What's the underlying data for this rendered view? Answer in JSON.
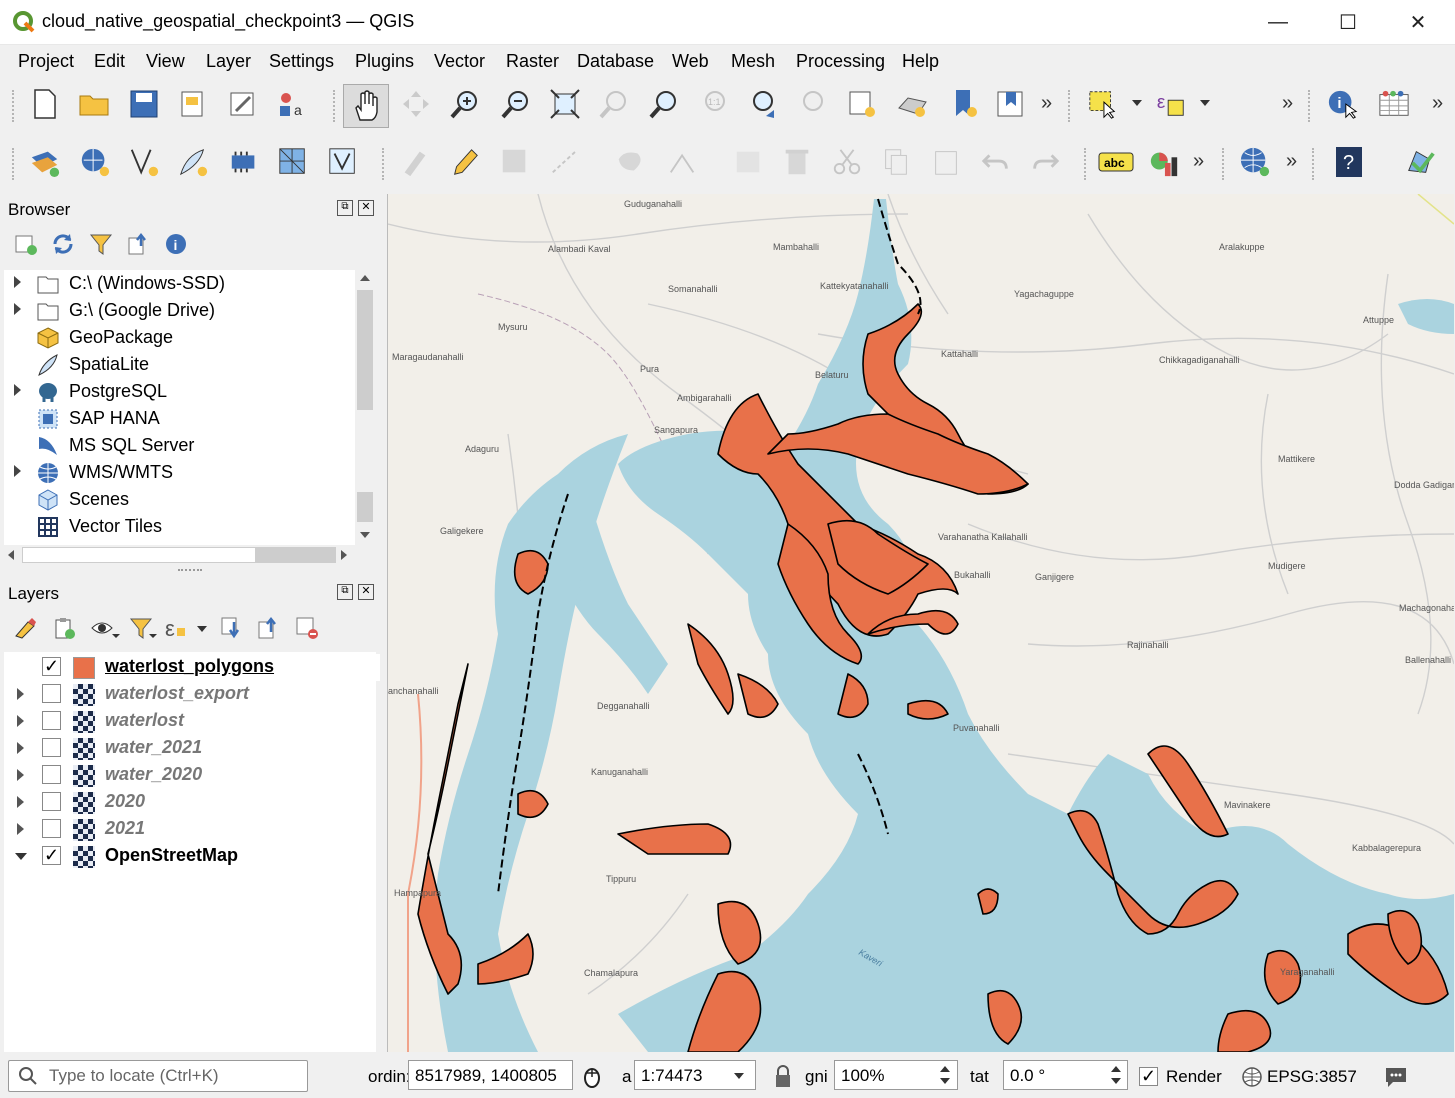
{
  "window": {
    "title": "cloud_native_geospatial_checkpoint3 — QGIS",
    "minimize_glyph": "—",
    "maximize_glyph": "☐",
    "close_glyph": "✕"
  },
  "menu": [
    {
      "label": "Project"
    },
    {
      "label": "Edit"
    },
    {
      "label": "View"
    },
    {
      "label": "Layer"
    },
    {
      "label": "Settings"
    },
    {
      "label": "Plugins"
    },
    {
      "label": "Vector"
    },
    {
      "label": "Raster"
    },
    {
      "label": "Database"
    },
    {
      "label": "Web"
    },
    {
      "label": "Mesh"
    },
    {
      "label": "Processing"
    },
    {
      "label": "Help"
    }
  ],
  "toolbar_overflow": "»",
  "browser": {
    "title": "Browser",
    "items": [
      {
        "label": "C:\\ (Windows-SSD)",
        "icon": "folder-icon",
        "expandable": true
      },
      {
        "label": "G:\\ (Google Drive)",
        "icon": "folder-icon",
        "expandable": true
      },
      {
        "label": "GeoPackage",
        "icon": "geopackage-icon",
        "expandable": false
      },
      {
        "label": "SpatiaLite",
        "icon": "spatialite-feather-icon",
        "expandable": false
      },
      {
        "label": "PostgreSQL",
        "icon": "postgresql-elephant-icon",
        "expandable": true
      },
      {
        "label": "SAP HANA",
        "icon": "sap-hana-icon",
        "expandable": false
      },
      {
        "label": "MS SQL Server",
        "icon": "mssql-icon",
        "expandable": false
      },
      {
        "label": "WMS/WMTS",
        "icon": "globe-icon",
        "expandable": true
      },
      {
        "label": "Scenes",
        "icon": "cube-icon",
        "expandable": false
      },
      {
        "label": "Vector Tiles",
        "icon": "grid-icon",
        "expandable": false
      }
    ]
  },
  "layers": {
    "title": "Layers",
    "items": [
      {
        "label": "waterlost_polygons",
        "checked": true,
        "check_glyph": "✓",
        "type": "polygon",
        "active": true
      },
      {
        "label": "waterlost_export",
        "checked": false,
        "check_glyph": "",
        "type": "raster",
        "active": false
      },
      {
        "label": "waterlost",
        "checked": false,
        "check_glyph": "",
        "type": "raster",
        "active": false
      },
      {
        "label": "water_2021",
        "checked": false,
        "check_glyph": "",
        "type": "raster",
        "active": false
      },
      {
        "label": "water_2020",
        "checked": false,
        "check_glyph": "",
        "type": "raster",
        "active": false
      },
      {
        "label": "2020",
        "checked": false,
        "check_glyph": "",
        "type": "raster",
        "active": false
      },
      {
        "label": "2021",
        "checked": false,
        "check_glyph": "",
        "type": "raster",
        "active": false
      },
      {
        "label": "OpenStreetMap",
        "checked": true,
        "check_glyph": "✓",
        "type": "raster",
        "active": true
      }
    ]
  },
  "map": {
    "water_color": "#aad3df",
    "polygon_color": "#e8714a",
    "land_color": "#f2efe9",
    "place_labels": [
      "Guduganahalli",
      "Alambadi Kaval",
      "Mambahalli",
      "Somanahalli",
      "Kattekyatanahalli",
      "Yagachaguppe",
      "Aralakuppe",
      "Attuppe",
      "Maragaudanahalli",
      "Mysuru",
      "Kattahalli",
      "Chikkagadiganahalli",
      "Pura",
      "Belaturu",
      "Ambigarahalli",
      "Sangapura",
      "Adaguru",
      "Mattikere",
      "Dodda Gadiganahalli",
      "Galigekere",
      "Varahanatha Kallahalli",
      "Bukahalli",
      "Ganjigere",
      "Mudigere",
      "Machagonahalli",
      "Rajinahalli",
      "Ballenahalli",
      "anchanahalli",
      "Degganahalli",
      "Puvanahalli",
      "Kanuganahalli",
      "Mavinakere",
      "Kabbalagerepura",
      "Tippuru",
      "Hampapura",
      "Chamalapura",
      "Yaraganahalli",
      "Kaveri"
    ]
  },
  "status": {
    "locate_placeholder": "Type to locate (Ctrl+K)",
    "coord_label": "ordin:",
    "coordinate": "8517989, 1400805",
    "scale_label": "a",
    "scale": "1:74473",
    "magnifier_label": "gni",
    "magnifier": "100%",
    "rotation_label": "tat",
    "rotation": "0.0 °",
    "render_label": "Render",
    "render_checked": "✓",
    "crs": "EPSG:3857"
  }
}
